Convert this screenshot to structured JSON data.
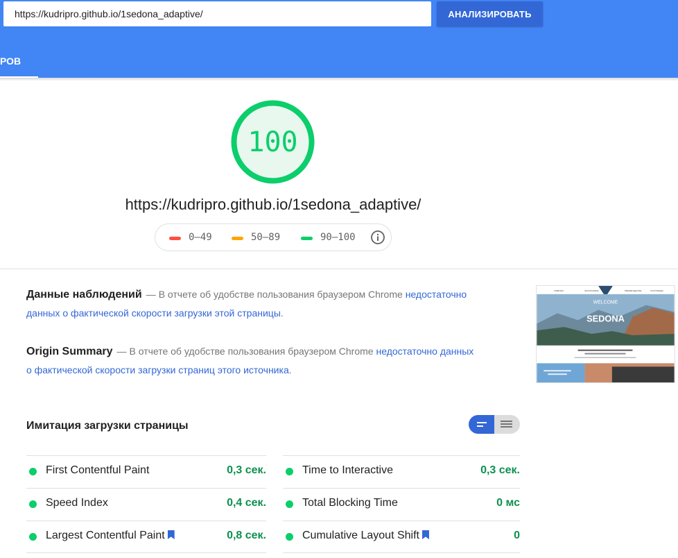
{
  "header": {
    "url_value": "https://kudripro.github.io/1sedona_adaptive/",
    "analyze_label": "АНАЛИЗИРОВАТЬ",
    "active_tab_label": "РОВ",
    "colors": {
      "header_bg": "#4285f4",
      "button_bg": "#3367d6"
    }
  },
  "score": {
    "value": "100",
    "url": "https://kudripro.github.io/1sedona_adaptive/",
    "color": "#0cce6b",
    "legend": [
      {
        "label": "0–49",
        "color": "#ff4e42"
      },
      {
        "label": "50–89",
        "color": "#ffa400"
      },
      {
        "label": "90–100",
        "color": "#0cce6b"
      }
    ],
    "info_icon": "info-circle-icon"
  },
  "field_data": {
    "title": "Данные наблюдений",
    "text_before": "В отчете об удобстве пользования браузером Chrome ",
    "link": "недостаточно данных о фактической скорости загрузки этой страницы",
    "text_after": "."
  },
  "origin_summary": {
    "title": "Origin Summary",
    "text_before": "В отчете об удобстве пользования браузером Chrome ",
    "link": "недостаточно данных о фактической скорости загрузки страниц этого источника",
    "text_after": "."
  },
  "thumbnail": {
    "brand": "SEDONA",
    "welcome": "WELCOME",
    "nav": [
      "ГЛАВНАЯ",
      "ФОТОГРАФИИ",
      "ПРЕИМУЩЕСТВА",
      "ГОСТИНИЦЫ"
    ]
  },
  "lab": {
    "title": "Имитация загрузки страницы",
    "toggle_icons": [
      "compact-view-icon",
      "expanded-view-icon"
    ],
    "metrics_left": [
      {
        "name": "First Contentful Paint",
        "value": "0,3 сек.",
        "bookmark": false
      },
      {
        "name": "Speed Index",
        "value": "0,4 сек.",
        "bookmark": false
      },
      {
        "name": "Largest Contentful Paint",
        "value": "0,8 сек.",
        "bookmark": true
      }
    ],
    "metrics_right": [
      {
        "name": "Time to Interactive",
        "value": "0,3 сек.",
        "bookmark": false
      },
      {
        "name": "Total Blocking Time",
        "value": "0 мс",
        "bookmark": false
      },
      {
        "name": "Cumulative Layout Shift",
        "value": "0",
        "bookmark": true
      }
    ]
  }
}
